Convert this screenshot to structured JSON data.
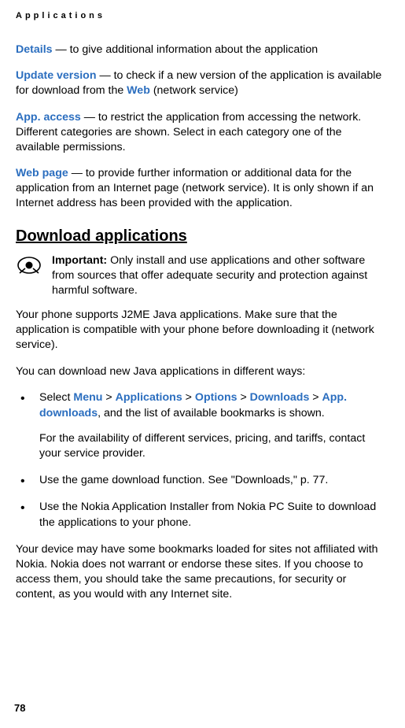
{
  "header": "Applications",
  "defs": {
    "details": {
      "term": "Details",
      "text": " — to give additional information about the application"
    },
    "update": {
      "term": "Update version",
      "t1": " — to check if a new version of the application is available for download from the ",
      "web": "Web",
      "t2": " (network service)"
    },
    "access": {
      "term": "App. access",
      "text": " — to restrict the application from accessing the network. Different categories are shown. Select in each category one of the available permissions."
    },
    "webpage": {
      "term": "Web page",
      "text": " — to provide further information or additional data for the application from an Internet page (network service). It is only shown if an Internet address has been provided with the application."
    }
  },
  "download": {
    "heading": "Download applications",
    "important_label": "Important:",
    "important_text": " Only install and use applications and other software from sources that offer adequate security and protection against harmful software.",
    "p1": "Your phone supports J2ME Java applications. Make sure that the application is compatible with your phone before downloading it (network service).",
    "p2": "You can download new Java applications in different ways:",
    "bullets": {
      "b1": {
        "select": "Select ",
        "menu": "Menu",
        "s1": " > ",
        "apps": "Applications",
        "s2": " > ",
        "opts": "Options",
        "s3": " > ",
        "dls": "Downloads",
        "s4": " > ",
        "appd": "App. downloads",
        "after": ", and the list of available bookmarks is shown.",
        "p2": "For the availability of different services, pricing, and tariffs, contact your service provider."
      },
      "b2": "Use the game download function. See \"Downloads,\" p. 77.",
      "b3": "Use the Nokia Application Installer from Nokia PC Suite to download the applications to your phone."
    },
    "p3": "Your device may have some bookmarks loaded for sites not affiliated with Nokia. Nokia does not warrant or endorse these sites. If you choose to access them, you should take the same precautions, for security or content, as you would with any Internet site."
  },
  "page_number": "78"
}
